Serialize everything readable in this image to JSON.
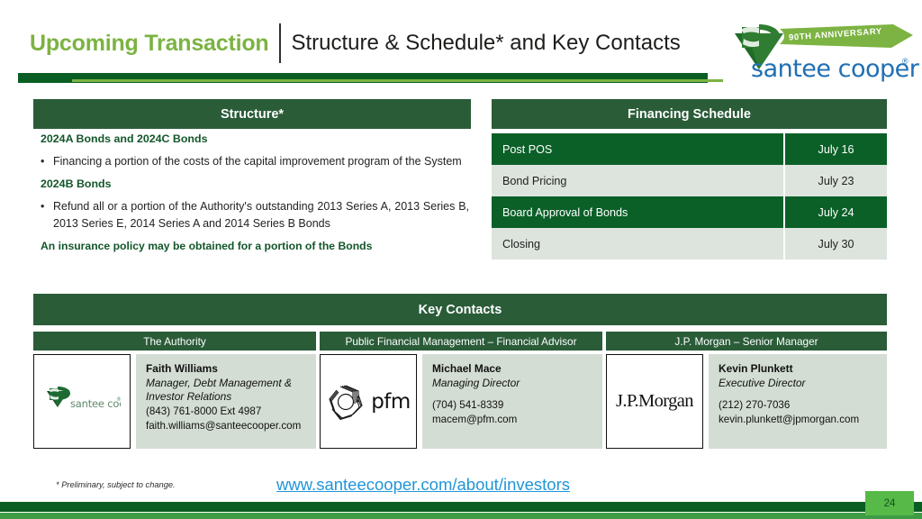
{
  "header": {
    "title_accent": "Upcoming Transaction",
    "title_main": "Structure & Schedule* and Key Contacts",
    "logo": {
      "ribbon_text": "90TH ANNIVERSARY",
      "wordmark": "santee cooper",
      "registered_mark": "®",
      "mark_name": "santee-cooper-diamond-logo"
    }
  },
  "structure": {
    "heading": "Structure*",
    "groups": [
      {
        "label": "2024A Bonds and 2024C Bonds",
        "bullet": "Financing a portion of the costs of the capital improvement program of the System"
      },
      {
        "label": "2024B Bonds",
        "bullet": "Refund all or a portion of the Authority's outstanding 2013 Series A, 2013 Series B, 2013 Series E, 2014 Series A and 2014 Series B Bonds"
      }
    ],
    "note": "An insurance policy may be obtained for a portion of the Bonds"
  },
  "schedule": {
    "heading": "Financing Schedule",
    "rows": [
      {
        "event": "Post POS",
        "date": "July 16"
      },
      {
        "event": "Bond Pricing",
        "date": "July 23"
      },
      {
        "event": "Board Approval of Bonds",
        "date": "July 24"
      },
      {
        "event": "Closing",
        "date": "July 30"
      }
    ]
  },
  "key_contacts": {
    "heading": "Key Contacts",
    "columns": [
      {
        "header": "The Authority",
        "logo_name": "santee-cooper-logo",
        "logo_text": "santee cooper",
        "name": "Faith Williams",
        "title_line_1": "Manager, Debt Management &",
        "title_line_2": "Investor Relations",
        "phone": "(843) 761-8000 Ext 4987",
        "email": "faith.williams@santeecooper.com"
      },
      {
        "header": "Public Financial Management – Financial Advisor",
        "logo_name": "pfm-logo",
        "logo_text": "pfm",
        "name": "Michael Mace",
        "title_line_1": "Managing Director",
        "title_line_2": "",
        "phone": "(704) 541-8339",
        "email": "macem@pfm.com"
      },
      {
        "header": "J.P. Morgan – Senior Manager",
        "logo_name": "jpmorgan-logo",
        "logo_text": "J.P.Morgan",
        "name": "Kevin Plunkett",
        "title_line_1": "Executive Director",
        "title_line_2": "",
        "phone": "(212) 270-7036",
        "email": "kevin.plunkett@jpmorgan.com"
      }
    ]
  },
  "footer": {
    "footnote": "* Preliminary, subject to change.",
    "investor_link": "www.santeecooper.com/about/investors",
    "page_number": "24"
  },
  "colors": {
    "dark_green": "#0a5e23",
    "panel_green": "#2a5c38",
    "row_green": "#0b6028",
    "row_light": "#dde4dd",
    "accent_light_green": "#7cb342",
    "card_bg": "#d3ddd3",
    "link_blue": "#2196d8",
    "badge_green": "#57b947"
  }
}
